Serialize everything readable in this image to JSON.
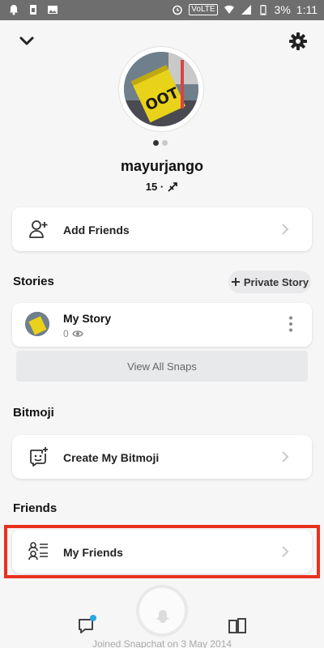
{
  "status_bar": {
    "volte": "VoLTE",
    "battery": "3%",
    "time": "1:11"
  },
  "profile": {
    "username": "mayurjango",
    "score": "15 ·"
  },
  "add_friends": {
    "label": "Add Friends"
  },
  "stories": {
    "title": "Stories",
    "private_story": "Private Story",
    "my_story": {
      "title": "My Story",
      "views": "0"
    },
    "view_all": "View All Snaps"
  },
  "bitmoji": {
    "title": "Bitmoji",
    "create_label": "Create My Bitmoji"
  },
  "friends": {
    "title": "Friends",
    "my_friends_label": "My Friends"
  },
  "footer": {
    "joined": "Joined Snapchat on 3 May 2014"
  },
  "colors": {
    "highlight": "#e8311f",
    "chat_badge": "#2aa7e0",
    "avatar_accent": "#e8d21a"
  },
  "icons": [
    "chevron-down-icon",
    "gear-icon",
    "add-friend-icon",
    "bitmoji-icon",
    "friends-list-icon",
    "eye-icon",
    "kebab-icon",
    "chat-icon",
    "discover-icon",
    "ghost-icon"
  ]
}
